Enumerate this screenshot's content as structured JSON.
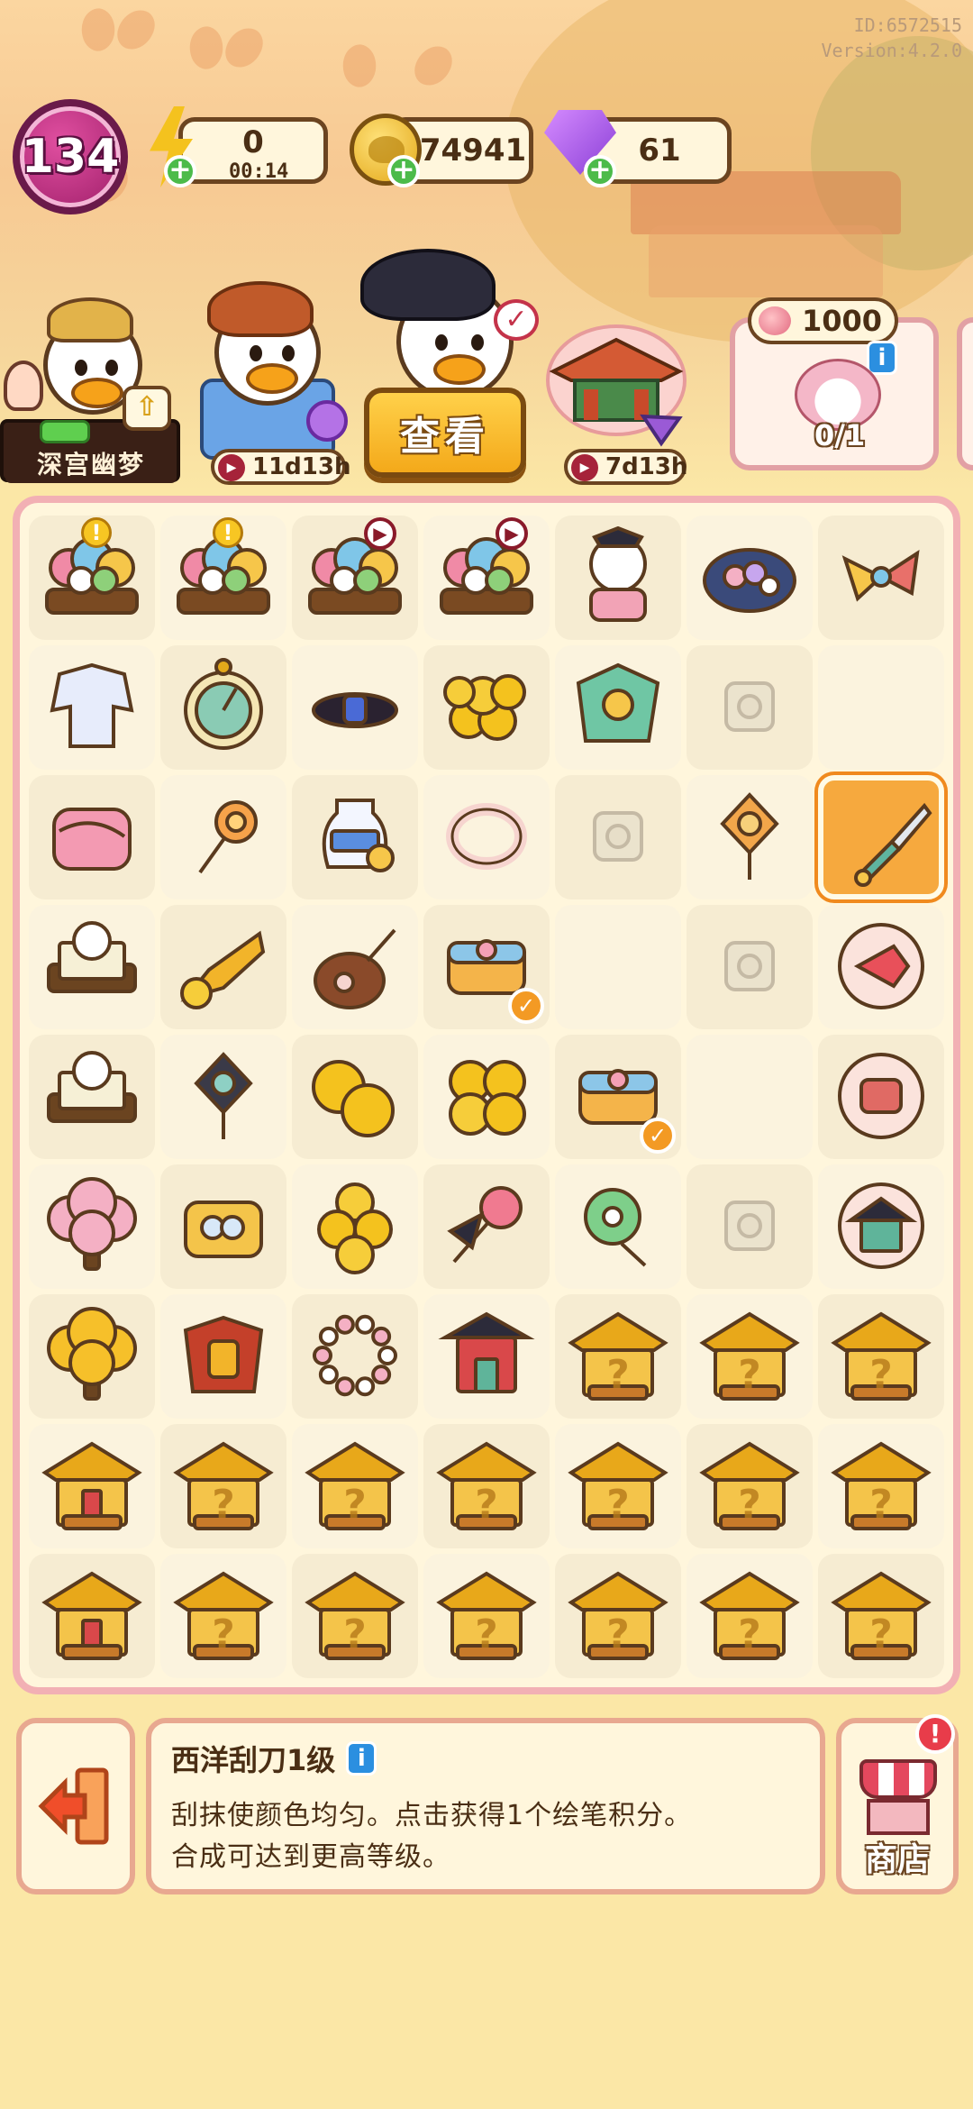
{
  "build": {
    "id": "ID:6572515",
    "version": "Version:4.2.0"
  },
  "hud": {
    "level": "134",
    "energy": "0",
    "energy_timer": "00:14",
    "coins": "74941",
    "gems": "61"
  },
  "characters": {
    "scholar_name": "深宫幽梦",
    "merchant_timer": "11d13h",
    "view_button": "查看",
    "pavilion_timer": "7d13h"
  },
  "event": {
    "points": "1000",
    "progress": "0/1"
  },
  "colors": {
    "board_border": "#f2b0b4",
    "accent": "#f6a93e",
    "level": "#c02e82"
  },
  "board": {
    "rows": [
      [
        "flower-cart",
        "flower-cart",
        "flower-cart",
        "flower-cart",
        "guzheng-lady",
        "flower-plate",
        "pinwheel-fan"
      ],
      [
        "silk-robe",
        "compass",
        "hair-tie",
        "coin-pile",
        "jade-screen",
        "locked",
        "empty"
      ],
      [
        "pink-silk",
        "flower-hairpin",
        "blue-vase",
        "jade-bangle",
        "locked",
        "chinese-knot",
        "palette-knife"
      ],
      [
        "embroidery-frame",
        "brass-horn",
        "pipa-lute",
        "fabric-bundle",
        "empty",
        "locked",
        "koi-badge"
      ],
      [
        "embroidery-frame",
        "chinese-knot-dark",
        "coin-pair",
        "coin-stack",
        "fabric-bundle",
        "empty",
        "jade-box"
      ],
      [
        "peach-tree",
        "pearl-box",
        "coin-stack-small",
        "rose-hairpin",
        "jade-pendant",
        "locked",
        "palace-badge"
      ],
      [
        "osmanthus-tree",
        "warrior-armor",
        "pearl-bracelet",
        "gate-tower",
        "mystery-palace",
        "mystery-palace",
        "mystery-palace"
      ],
      [
        "golden-hall",
        "mystery-palace",
        "mystery-palace",
        "mystery-palace",
        "mystery-palace",
        "mystery-palace",
        "mystery-palace"
      ],
      [
        "golden-gate",
        "mystery-palace",
        "mystery-palace",
        "mystery-palace",
        "mystery-palace",
        "mystery-palace",
        "mystery-palace"
      ]
    ]
  },
  "selected_item": {
    "title": "西洋刮刀1级",
    "desc_line1": "刮抹使颜色均匀。点击获得1个绘笔积分。",
    "desc_line2": "合成可达到更高等级。"
  },
  "shop": {
    "label": "商店"
  }
}
